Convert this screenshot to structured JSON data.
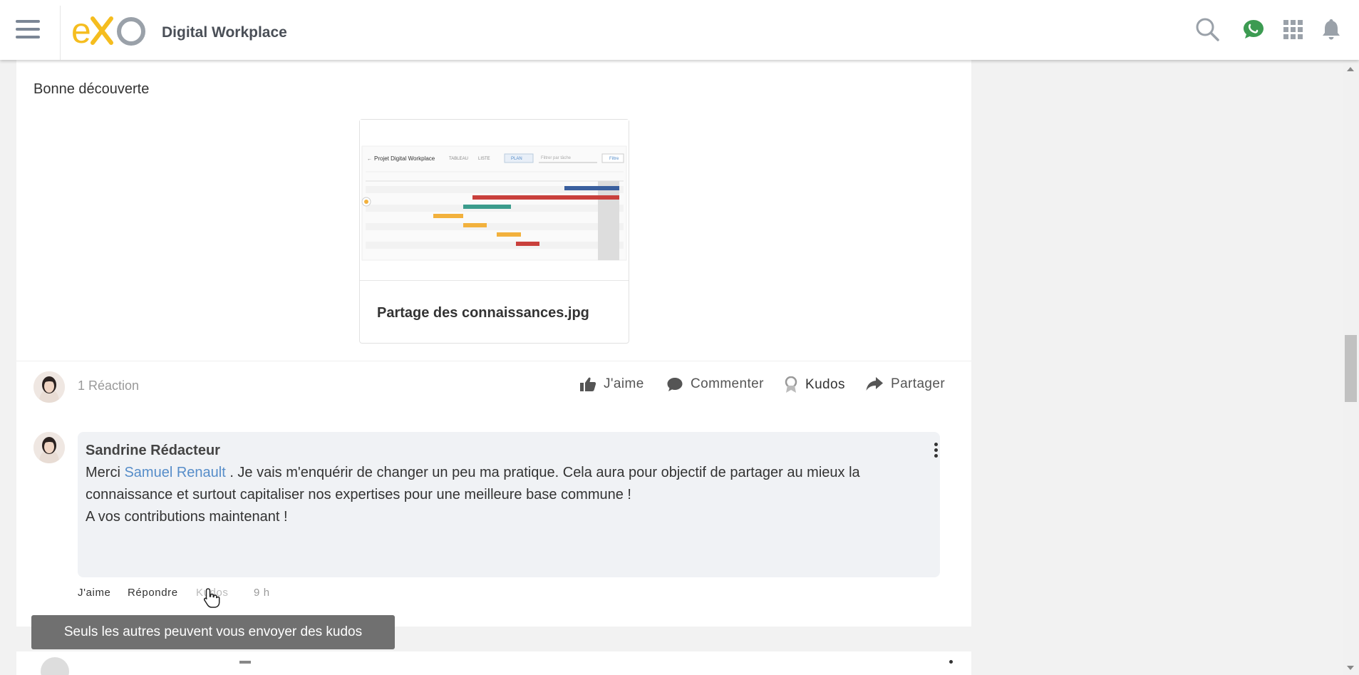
{
  "app": {
    "brand": "Digital Workplace",
    "logo_text": "eXo"
  },
  "topbar": {
    "icons": [
      "hamburger-icon",
      "search-icon",
      "chat-icon",
      "apps-grid-icon",
      "bell-icon"
    ],
    "chat_color": "#3c9b52"
  },
  "post": {
    "intro": "Bonne découverte",
    "attachment": {
      "name": "Partage des connaissances.jpg",
      "thumbnail": {
        "title": "Projet Digital Workplace",
        "views": [
          "TABLEAU",
          "LISTE",
          "PLAN"
        ],
        "filter_placeholder": "Filtrer par tâche",
        "filter_button": "Filtre"
      }
    },
    "reactions": "1 Réaction",
    "actions": {
      "like": "J'aime",
      "comment": "Commenter",
      "kudos": "Kudos",
      "share": "Partager"
    }
  },
  "comment": {
    "author": "Sandrine Rédacteur",
    "text_prefix": "Merci",
    "mention": "Samuel Renault",
    "text_line1": " . Je vais m'enquérir de changer un peu ma pratique. Cela aura pour objectif de partager au mieux la connaissance et surtout capitaliser nos expertises pour une meilleure base commune !",
    "text_line2": "A vos contributions maintenant !",
    "actions": {
      "like": "J'aime",
      "reply": "Répondre",
      "kudos": "Kudos",
      "time": "9 h"
    }
  },
  "tooltip": "Seuls les autres peuvent vous envoyer des kudos",
  "colors": {
    "logo_yellow": "#f5bd1f",
    "logo_grey": "#9aa1a9",
    "mention": "#568dc9",
    "tooltip_bg": "#707070"
  }
}
